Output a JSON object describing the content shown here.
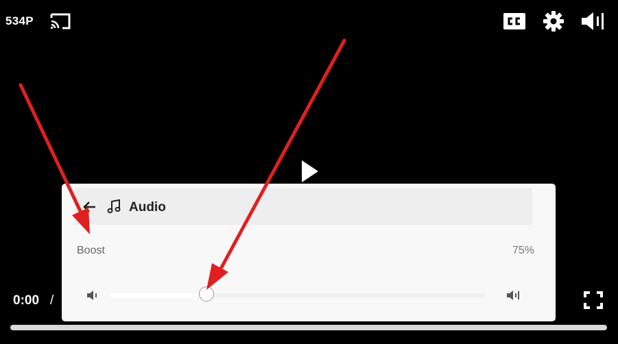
{
  "player": {
    "quality_label": "534P",
    "time_current": "0:00",
    "time_separator": "/",
    "playback_progress": 0
  },
  "icons": {
    "cast": "cast-icon",
    "captions": "closed-captions-icon",
    "settings": "gear-icon",
    "volume": "volume-icon",
    "play": "play-icon",
    "fullscreen": "fullscreen-icon",
    "back": "arrow-left-icon",
    "music": "music-note-icon",
    "volume_low": "volume-low-icon",
    "volume_high": "volume-high-icon"
  },
  "audio_panel": {
    "title": "Audio",
    "boost": {
      "label": "Boost",
      "value_text": "75%",
      "slider_fraction": 0.26
    }
  },
  "colors": {
    "background": "#000000",
    "panel": "#f8f8f8",
    "annotation_arrow": "#e02020"
  }
}
